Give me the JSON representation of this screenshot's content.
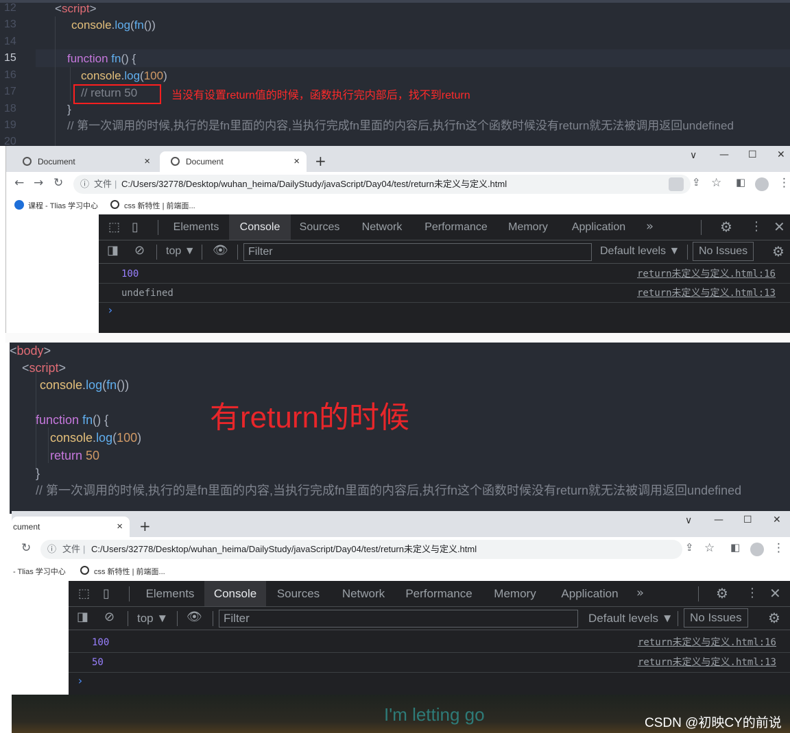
{
  "panel1": {
    "line_numbers": [
      "12",
      "13",
      "14",
      "15",
      "16",
      "17",
      "18",
      "19",
      "20"
    ],
    "code": {
      "script_open_lt": "<",
      "script_open_tag": "script",
      "script_open_gt": ">",
      "console_obj": "console",
      "dot": ".",
      "log_fn": "log",
      "paren_open": "(",
      "fn_call": "fn",
      "call_args": "()",
      "paren_close": ")",
      "function_kw": "function",
      "fn_name": "fn",
      "fn_sig": "() {",
      "num_100": "100",
      "commented_return": "// return 50",
      "close_brace": "}",
      "comment": "// 第一次调用的时候,执行的是fn里面的内容,当执行完成fn里面的内容后,执行fn这个函数时候没有return就无法被调用返回undefined"
    },
    "annotation": "当没有设置return值的时候，函数执行完内部后，找不到return",
    "annotation_color": "#ff2a2a"
  },
  "browser1": {
    "tabs": [
      {
        "label": "Document",
        "close": "×"
      },
      {
        "label": "Document",
        "close": "×"
      }
    ],
    "new_tab": "+",
    "window_controls": [
      "∨",
      "—",
      "☐",
      "✕"
    ],
    "url_prefix": "文件",
    "url": "C:/Users/32778/Desktop/wuhan_heima/DailyStudy/javaScript/Day04/test/return未定义与定义.html",
    "bookmarks": [
      {
        "icon": "bookmark-app-icon",
        "label": "课程 - Tlias 学习中心"
      },
      {
        "icon": "globe-icon",
        "label": "css 新特性 | 前端面..."
      }
    ],
    "devtools": {
      "tabs": [
        "Elements",
        "Console",
        "Sources",
        "Network",
        "Performance",
        "Memory",
        "Application"
      ],
      "more": "»",
      "context": "top ▼",
      "filter_placeholder": "Filter",
      "levels": "Default levels ▼",
      "issues": "No Issues",
      "rows": [
        {
          "value": "100",
          "source": "return未定义与定义.html:16",
          "kind": "number"
        },
        {
          "value": "undefined",
          "source": "return未定义与定义.html:13",
          "kind": "undefined"
        }
      ],
      "prompt": "›"
    }
  },
  "panel2": {
    "code": {
      "body_lt": "<",
      "body_tag": "body",
      "body_gt": ">",
      "script_lt": "<",
      "script_tag": "script",
      "script_gt": ">",
      "console_obj": "console",
      "dot": ".",
      "log_fn": "log",
      "paren_open": "(",
      "fn_call": "fn",
      "call_args": "()",
      "paren_close": ")",
      "function_kw": "function",
      "fn_name": "fn",
      "fn_sig": "() {",
      "num_100": "100",
      "return_kw": "return",
      "num_50": "50",
      "close_brace": "}",
      "comment": "// 第一次调用的时候,执行的是fn里面的内容,当执行完成fn里面的内容后,执行fn这个函数时候没有return就无法被调用返回undefined"
    },
    "heading": "有return的时候",
    "heading_color": "#e8262a"
  },
  "browser2": {
    "tabs": [
      {
        "label": "cument",
        "close": "×"
      }
    ],
    "new_tab": "+",
    "window_controls": [
      "∨",
      "—",
      "☐",
      "✕"
    ],
    "url_prefix": "文件",
    "url": "C:/Users/32778/Desktop/wuhan_heima/DailyStudy/javaScript/Day04/test/return未定义与定义.html",
    "bookmarks": [
      {
        "icon": "bookmark-app-icon",
        "label": "- Tlias 学习中心"
      },
      {
        "icon": "globe-icon",
        "label": "css 新特性 | 前端面..."
      }
    ],
    "devtools": {
      "tabs": [
        "Elements",
        "Console",
        "Sources",
        "Network",
        "Performance",
        "Memory",
        "Application"
      ],
      "more": "»",
      "context": "top ▼",
      "filter_placeholder": "Filter",
      "levels": "Default levels ▼",
      "issues": "No Issues",
      "rows": [
        {
          "value": "100",
          "source": "return未定义与定义.html:16",
          "kind": "number"
        },
        {
          "value": "50",
          "source": "return未定义与定义.html:13",
          "kind": "number"
        }
      ],
      "prompt": "›"
    }
  },
  "footer": {
    "lyric": "I'm letting go",
    "watermark": "CSDN @初映CY的前说"
  }
}
